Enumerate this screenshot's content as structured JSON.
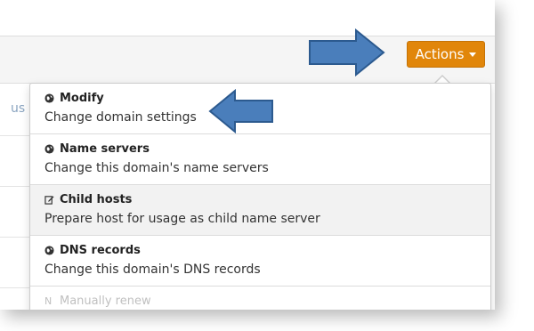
{
  "header": {
    "actions_label": "Actions"
  },
  "background": {
    "partial_text": "us"
  },
  "menu": {
    "items": [
      {
        "title": "Modify",
        "description": "Change domain settings",
        "icon": "globe-icon"
      },
      {
        "title": "Name servers",
        "description": "Change this domain's name servers",
        "icon": "globe-icon"
      },
      {
        "title": "Child hosts",
        "description": "Prepare host for usage as child name server",
        "icon": "edit-icon"
      },
      {
        "title": "DNS records",
        "description": "Change this domain's DNS records",
        "icon": "globe-icon"
      },
      {
        "title": "Manually renew",
        "description": "",
        "icon": "renew-icon"
      }
    ]
  },
  "colors": {
    "accent": "#e1860a",
    "arrow": "#4a7ebb",
    "arrow_outline": "#2c5a8f"
  }
}
